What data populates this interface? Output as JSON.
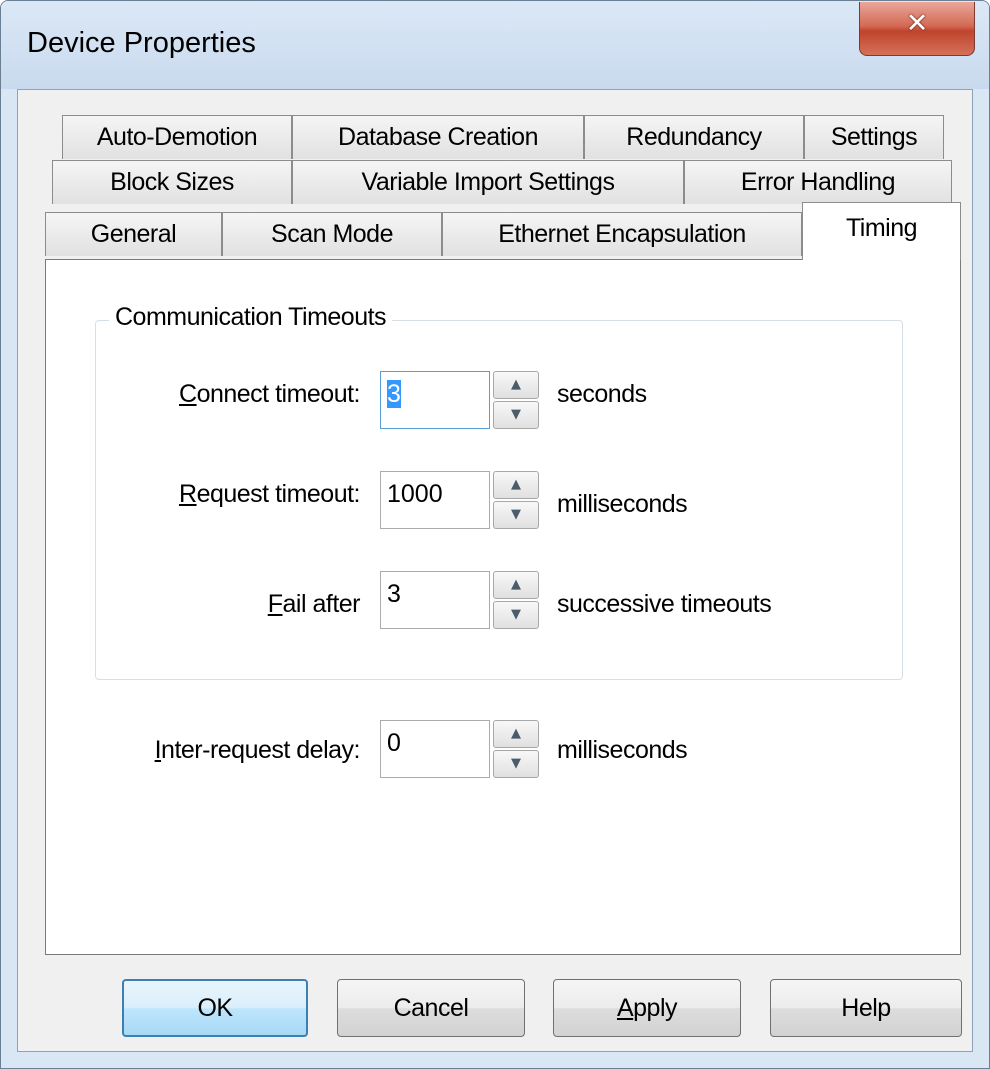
{
  "window": {
    "title": "Device Properties"
  },
  "tabs": {
    "row1": [
      "Auto-Demotion",
      "Database Creation",
      "Redundancy",
      "Settings"
    ],
    "row2": [
      "Block Sizes",
      "Variable Import Settings",
      "Error Handling"
    ],
    "row3": [
      "General",
      "Scan Mode",
      "Ethernet Encapsulation",
      "Timing"
    ],
    "active": "Timing"
  },
  "timing": {
    "group_title": "Communication Timeouts",
    "connect": {
      "label_key": "C",
      "label_rest": "onnect timeout:",
      "value": "3",
      "unit": "seconds"
    },
    "request": {
      "label_key": "R",
      "label_rest": "equest timeout:",
      "value": "1000",
      "unit": "milliseconds"
    },
    "fail": {
      "label_key": "F",
      "label_rest": "ail after",
      "value": "3",
      "unit": "successive timeouts"
    },
    "inter": {
      "label_key": "I",
      "label_rest": "nter-request delay:",
      "value": "0",
      "unit": "milliseconds"
    }
  },
  "buttons": {
    "ok": "OK",
    "cancel": "Cancel",
    "apply_key": "A",
    "apply_rest": "pply",
    "help": "Help"
  }
}
